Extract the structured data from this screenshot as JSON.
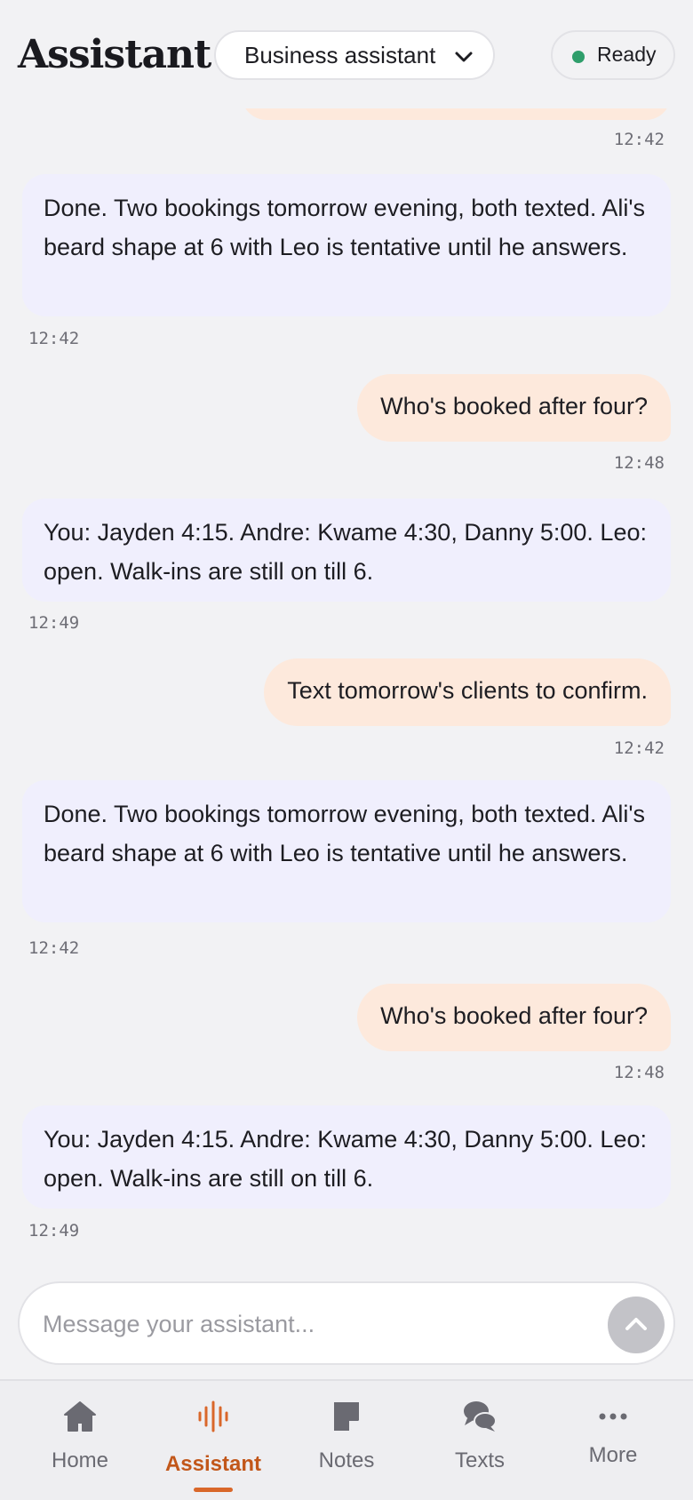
{
  "header": {
    "title": "Assistant",
    "mode_select": {
      "selected": "Business assistant"
    },
    "status": {
      "label": "Ready",
      "color": "#2f9e6b"
    }
  },
  "messages": [
    {
      "role": "user",
      "text": "",
      "time": "12:42"
    },
    {
      "role": "assistant",
      "text": "Done. Two bookings tomorrow evening, both texted. Ali's beard shape at 6 with Leo is tentative until he answers.",
      "time": "12:42"
    },
    {
      "role": "user",
      "text": "Who's booked after four?",
      "time": "12:48"
    },
    {
      "role": "assistant",
      "text": "You: Jayden 4:15. Andre: Kwame 4:30, Danny 5:00. Leo: open. Walk-ins are still on till 6.",
      "time": "12:49"
    },
    {
      "role": "user",
      "text": "Text tomorrow's clients to confirm.",
      "time": "12:42"
    },
    {
      "role": "assistant",
      "text": "Done. Two bookings tomorrow evening, both texted. Ali's beard shape at 6 with Leo is tentative until he answers.",
      "time": "12:42"
    },
    {
      "role": "user",
      "text": "Who's booked after four?",
      "time": "12:48"
    },
    {
      "role": "assistant",
      "text": "You: Jayden 4:15. Andre: Kwame 4:30, Danny 5:00. Leo: open. Walk-ins are still on till 6.",
      "time": "12:49"
    }
  ],
  "composer": {
    "placeholder": "Message your assistant...",
    "send_icon": "chevron-up-icon"
  },
  "nav": {
    "active": "Assistant",
    "accent_color": "#c2571a",
    "items": [
      {
        "label": "Home",
        "icon": "home-icon"
      },
      {
        "label": "Assistant",
        "icon": "voice-waveform-icon"
      },
      {
        "label": "Notes",
        "icon": "note-icon"
      },
      {
        "label": "Texts",
        "icon": "chat-bubbles-icon"
      },
      {
        "label": "More",
        "icon": "more-dots-icon"
      }
    ]
  }
}
